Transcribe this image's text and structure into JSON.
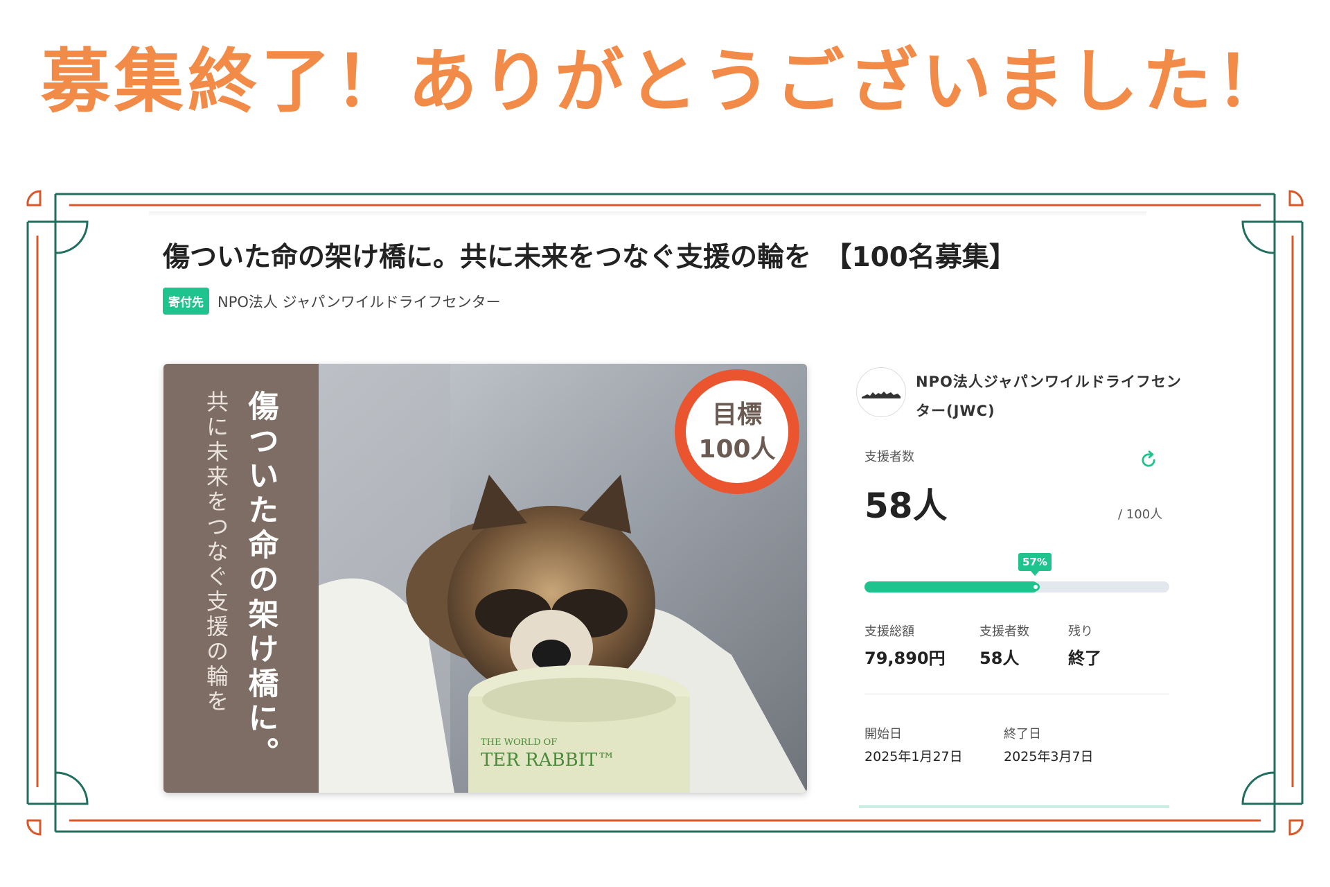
{
  "headline": "募集終了！ありがとうございました！",
  "campaign": {
    "title": "傷ついた命の架け橋に。共に未来をつなぐ支援の輪を　【100名募集】",
    "badge": "寄付先",
    "org_name": "NPO法人 ジャパンワイルドライフセンター"
  },
  "hero": {
    "vertical_title": "傷ついた命の架け橋に。",
    "vertical_subtitle": "共に未来をつなぐ支援の輪を",
    "goal_label": "目標",
    "goal_value": "100人",
    "bowl_text_small": "THE WORLD OF",
    "bowl_text_large": "TER RABBIT™"
  },
  "organization": {
    "name": "NPO法人ジャパンワイルドライフセンター(JWC)",
    "logo_icon": "wildlife-silhouette-logo-icon"
  },
  "supporters": {
    "label": "支援者数",
    "count": "58人",
    "goal": "/ 100人",
    "percent_label": "57%",
    "progress": 0.57,
    "refresh_icon": "refresh-icon"
  },
  "stats": [
    {
      "label": "支援総額",
      "value": "79,890円"
    },
    {
      "label": "支援者数",
      "value": "58人"
    },
    {
      "label": "残り",
      "value": "終了"
    }
  ],
  "dates": [
    {
      "label": "開始日",
      "value": "2025年1月27日"
    },
    {
      "label": "終了日",
      "value": "2025年3月7日"
    }
  ],
  "colors": {
    "headline_orange": "#f28a48",
    "frame_green": "#1f6e5e",
    "frame_orange": "#d9582a",
    "accent_green": "#1fc38e",
    "hero_panel_brown": "#7d6d64",
    "goal_circle_red": "#ea5530"
  }
}
